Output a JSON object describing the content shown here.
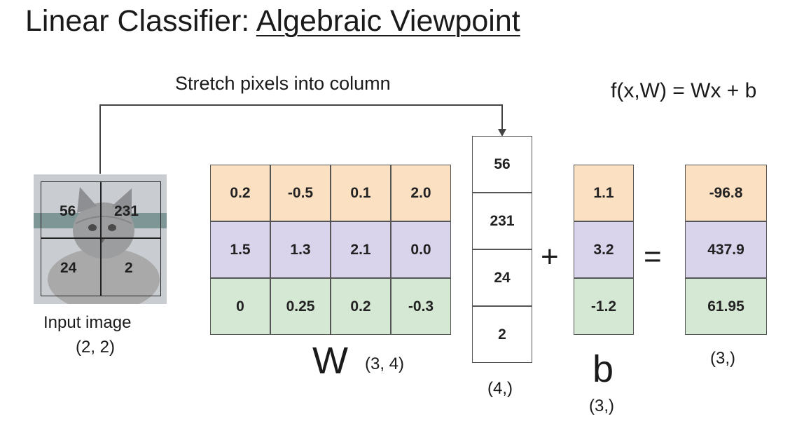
{
  "title": {
    "main": "Linear Classifier: ",
    "sub": "Algebraic Viewpoint"
  },
  "stretch_label": "Stretch pixels into column",
  "formula": "f(x,W) = Wx + b",
  "input_image": {
    "pixels": [
      "56",
      "231",
      "24",
      "2"
    ],
    "caption": "Input image",
    "shape": "(2, 2)"
  },
  "W": {
    "rows": [
      [
        "0.2",
        "-0.5",
        "0.1",
        "2.0"
      ],
      [
        "1.5",
        "1.3",
        "2.1",
        "0.0"
      ],
      [
        "0",
        "0.25",
        "0.2",
        "-0.3"
      ]
    ],
    "label": "W",
    "shape": "(3, 4)"
  },
  "x": {
    "values": [
      "56",
      "231",
      "24",
      "2"
    ],
    "shape": "(4,)"
  },
  "plus": "+",
  "b": {
    "values": [
      "1.1",
      "3.2",
      "-1.2"
    ],
    "label": "b",
    "shape": "(3,)"
  },
  "equals": "=",
  "result": {
    "values": [
      "-96.8",
      "437.9",
      "61.95"
    ],
    "shape": "(3,)"
  },
  "colors": {
    "row1": "#fbe0c2",
    "row2": "#d9d4ec",
    "row3": "#d5e8d4",
    "line": "#444444"
  }
}
